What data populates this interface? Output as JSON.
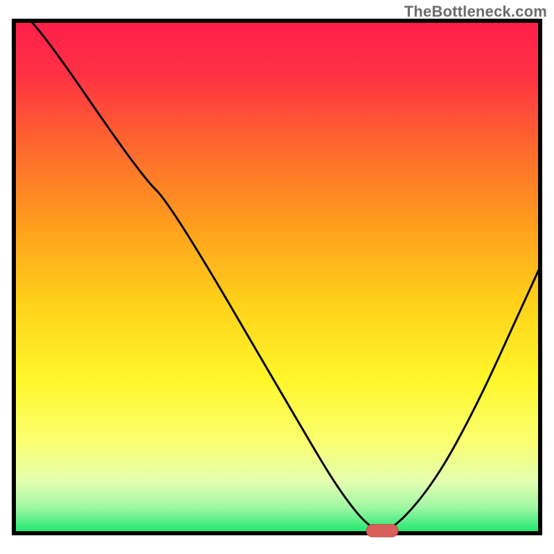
{
  "watermark": "TheBottleneck.com",
  "colors": {
    "frame": "#000000",
    "curve": "#000000",
    "marker_fill": "#d9605a",
    "marker_stroke": "#b64c46",
    "gradient_stops": [
      {
        "offset": 0.0,
        "color": "#ff1f4b"
      },
      {
        "offset": 0.1,
        "color": "#ff3044"
      },
      {
        "offset": 0.25,
        "color": "#ff6a2e"
      },
      {
        "offset": 0.4,
        "color": "#ff9e1d"
      },
      {
        "offset": 0.55,
        "color": "#ffd21a"
      },
      {
        "offset": 0.7,
        "color": "#fff72a"
      },
      {
        "offset": 0.82,
        "color": "#fbff70"
      },
      {
        "offset": 0.9,
        "color": "#e3ffb0"
      },
      {
        "offset": 0.95,
        "color": "#9ef7a3"
      },
      {
        "offset": 1.0,
        "color": "#19e86f"
      }
    ]
  },
  "chart_data": {
    "type": "line",
    "title": "",
    "xlabel": "",
    "ylabel": "",
    "xlim": [
      0,
      100
    ],
    "ylim": [
      0,
      100
    ],
    "x": [
      0,
      4,
      24,
      30,
      55,
      62,
      68,
      72,
      80,
      88,
      96,
      100
    ],
    "values": [
      102,
      100,
      70,
      64,
      20,
      8,
      0.5,
      0.5,
      10,
      25,
      43,
      52
    ],
    "marker": {
      "x": 70,
      "y": 0.5
    },
    "notes": "V-shaped bottleneck curve on a red→green vertical gradient background. Y is mismatch percentage (higher = worse / red). Minimum (optimal) point near x≈70 marked with a red pill on the x-axis."
  }
}
